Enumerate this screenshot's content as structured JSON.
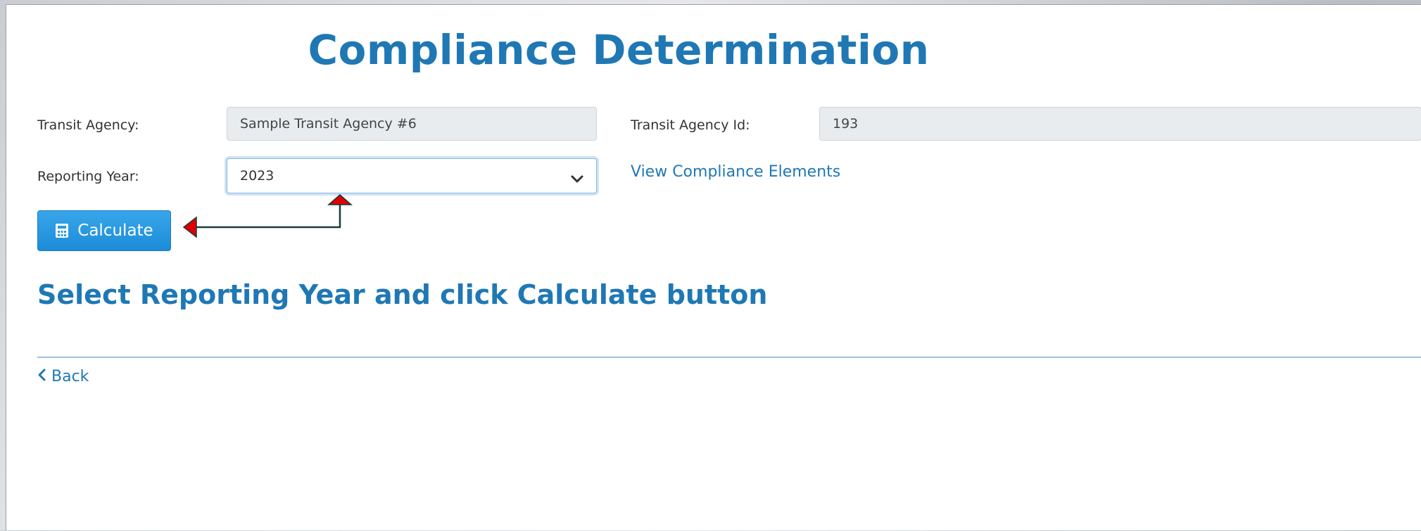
{
  "page": {
    "title": "Compliance Determination"
  },
  "form": {
    "transit_agency_label": "Transit Agency:",
    "transit_agency_value": "Sample Transit Agency #6",
    "transit_agency_id_label": "Transit Agency Id:",
    "transit_agency_id_value": "193",
    "reporting_year_label": "Reporting Year:",
    "reporting_year_value": "2023",
    "view_elements_link": "View Compliance Elements"
  },
  "actions": {
    "calculate_label": "Calculate",
    "back_label": "Back"
  },
  "instruction_text": "Select Reporting Year and click Calculate button",
  "icons": {
    "calculate": "calculator-icon",
    "dropdown": "chevron-down-icon",
    "back": "chevron-left-icon"
  },
  "colors": {
    "accent": "#1f78b4",
    "button": "#2a9be0",
    "readonly_bg": "#e9ecef",
    "annotation_arrow": "#e00000"
  }
}
